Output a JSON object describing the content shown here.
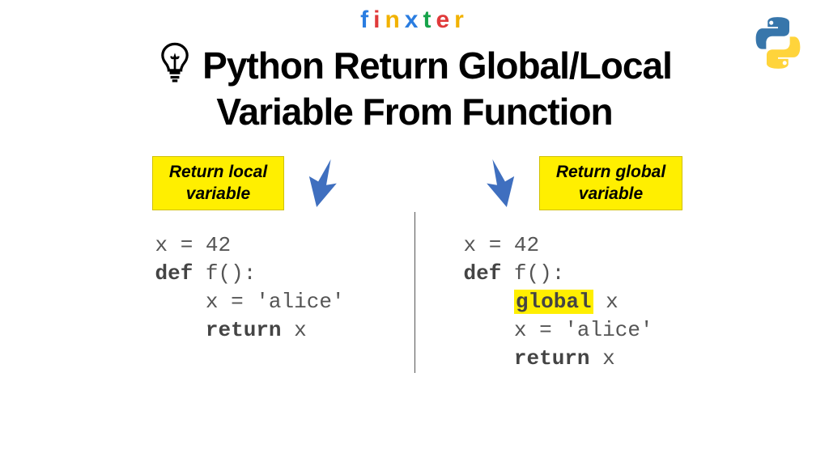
{
  "brand": {
    "letters": [
      "f",
      "i",
      "n",
      "x",
      "t",
      "e",
      "r"
    ],
    "colors": [
      "#2a7de1",
      "#e03a3a",
      "#f2b200",
      "#2a7de1",
      "#16a34a",
      "#e03a3a",
      "#f2b200"
    ]
  },
  "title": {
    "line1": "Python Return Global/Local",
    "line2": "Variable From Function"
  },
  "left": {
    "badge_l1": "Return local",
    "badge_l2": "variable",
    "code": {
      "l1": "x = 42",
      "l2a": "def",
      "l2b": " f():",
      "l3": "    x = 'alice'",
      "l4a": "    ",
      "l4b": "return",
      "l4c": " x"
    }
  },
  "right": {
    "badge_l1": "Return global",
    "badge_l2": "variable",
    "code": {
      "l1": "x = 42",
      "l2a": "def",
      "l2b": " f():",
      "l3a": "    ",
      "l3b": "global",
      "l3c": " x",
      "l4": "    x = 'alice'",
      "l5a": "    ",
      "l5b": "return",
      "l5c": " x"
    }
  },
  "colors": {
    "arrow": "#3f6fbf",
    "badge_bg": "#ffef00"
  }
}
